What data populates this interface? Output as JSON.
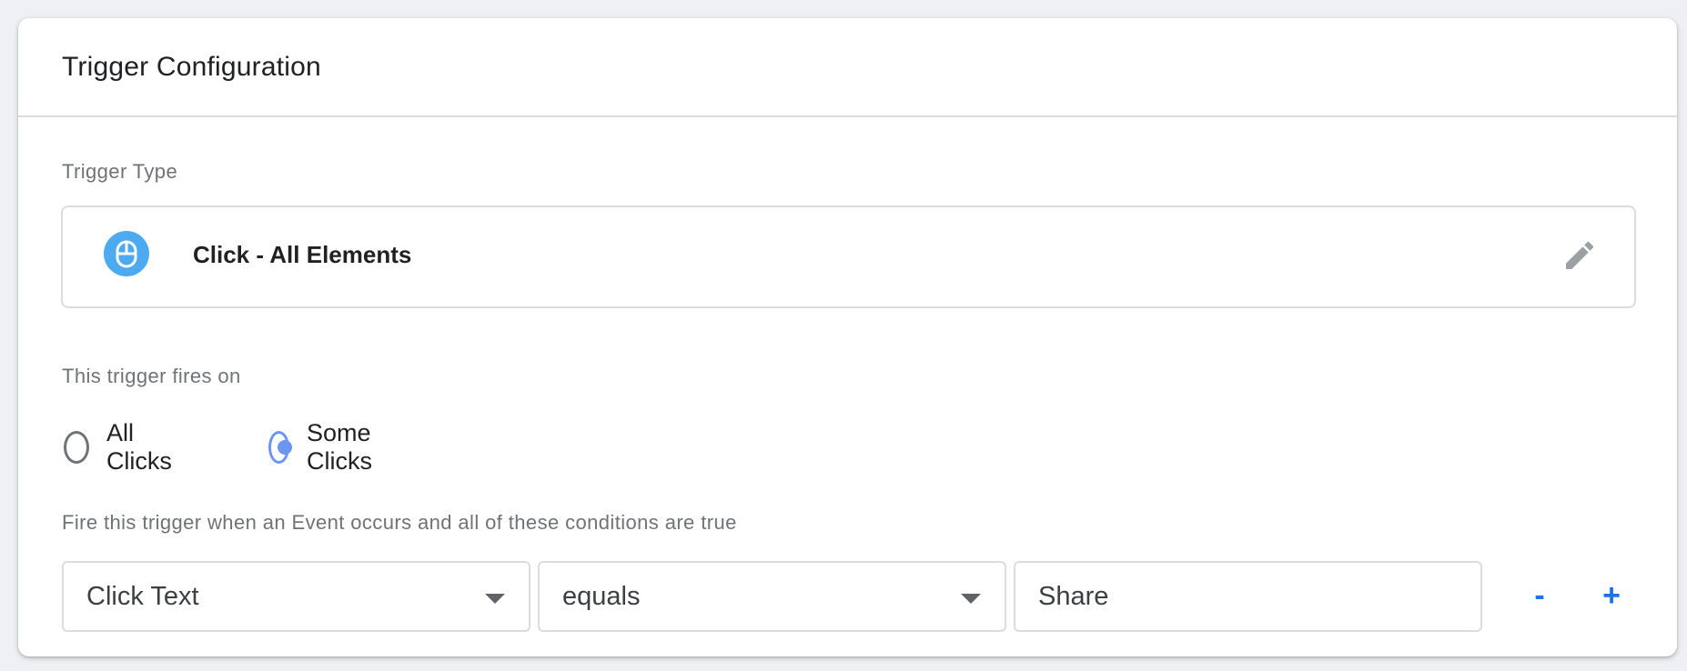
{
  "card": {
    "title": "Trigger Configuration"
  },
  "trigger_type": {
    "label": "Trigger Type",
    "name": "Click - All Elements",
    "icon": "mouse-icon",
    "edit_icon": "pencil-icon",
    "icon_color": "#4eaaf0"
  },
  "fires_on": {
    "label": "This trigger fires on",
    "options": [
      {
        "label": "All Clicks",
        "selected": false
      },
      {
        "label": "Some Clicks",
        "selected": true
      }
    ],
    "accent_color": "#6b95ef"
  },
  "conditions": {
    "label": "Fire this trigger when an Event occurs and all of these conditions are true",
    "rows": [
      {
        "variable": "Click Text",
        "operator": "equals",
        "value": "Share",
        "remove_label": "-",
        "add_label": "+"
      }
    ]
  }
}
